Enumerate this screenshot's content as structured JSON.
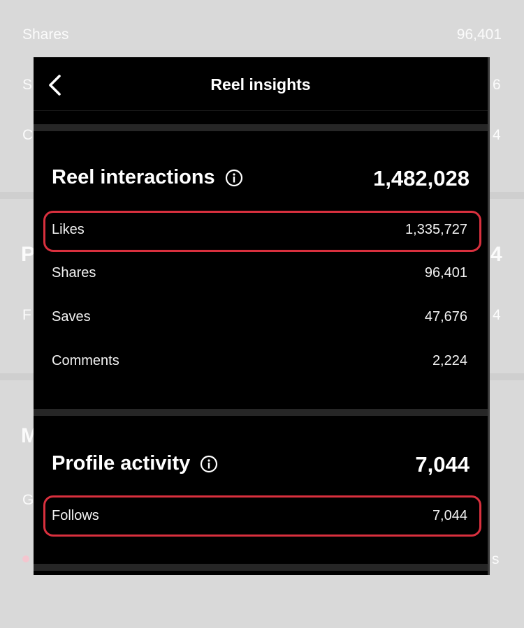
{
  "background": {
    "shares_label": "Shares",
    "shares_value": "96,401",
    "fragments": [
      "S",
      "6",
      "C",
      "4",
      "P",
      "4",
      "F",
      "4",
      "M",
      "G",
      "s"
    ]
  },
  "header": {
    "title": "Reel insights",
    "back_icon": "chevron-left-icon"
  },
  "reel_interactions": {
    "title": "Reel interactions",
    "total": "1,482,028",
    "rows": [
      {
        "label": "Likes",
        "value": "1,335,727",
        "highlighted": true
      },
      {
        "label": "Shares",
        "value": "96,401"
      },
      {
        "label": "Saves",
        "value": "47,676"
      },
      {
        "label": "Comments",
        "value": "2,224"
      }
    ]
  },
  "profile_activity": {
    "title": "Profile activity",
    "total": "7,044",
    "rows": [
      {
        "label": "Follows",
        "value": "7,044",
        "highlighted": true
      }
    ]
  },
  "colors": {
    "card_bg": "#000000",
    "page_bg": "#d9d9d9",
    "highlight": "#d9303e",
    "text": "#ffffff"
  }
}
